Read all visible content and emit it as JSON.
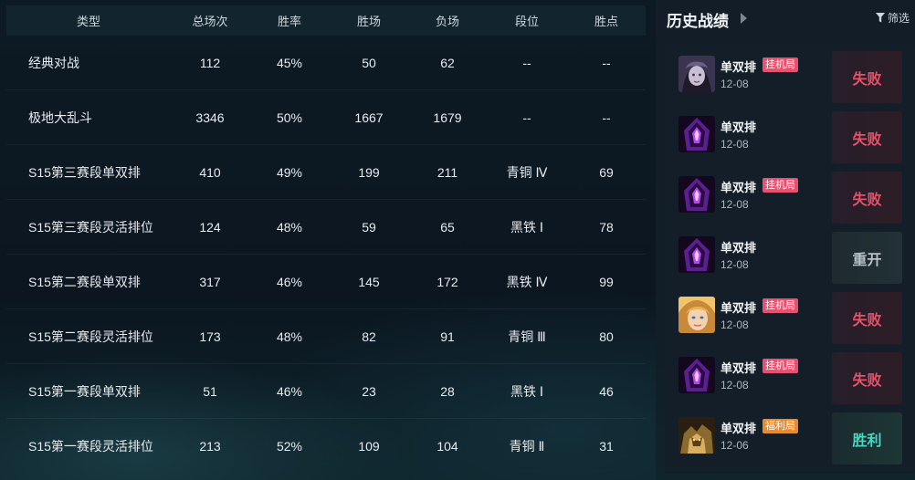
{
  "stats_table": {
    "headers": [
      "类型",
      "总场次",
      "胜率",
      "胜场",
      "负场",
      "段位",
      "胜点"
    ],
    "rows": [
      [
        "经典对战",
        "112",
        "45%",
        "50",
        "62",
        "--",
        "--"
      ],
      [
        "极地大乱斗",
        "3346",
        "50%",
        "1667",
        "1679",
        "--",
        "--"
      ],
      [
        "S15第三赛段单双排",
        "410",
        "49%",
        "199",
        "211",
        "青铜 Ⅳ",
        "69"
      ],
      [
        "S15第三赛段灵活排位",
        "124",
        "48%",
        "59",
        "65",
        "黑铁 Ⅰ",
        "78"
      ],
      [
        "S15第二赛段单双排",
        "317",
        "46%",
        "145",
        "172",
        "黑铁 Ⅳ",
        "99"
      ],
      [
        "S15第二赛段灵活排位",
        "173",
        "48%",
        "82",
        "91",
        "青铜 Ⅲ",
        "80"
      ],
      [
        "S15第一赛段单双排",
        "51",
        "46%",
        "23",
        "28",
        "黑铁 Ⅰ",
        "46"
      ],
      [
        "S15第一赛段灵活排位",
        "213",
        "52%",
        "109",
        "104",
        "青铜 Ⅱ",
        "31"
      ]
    ]
  },
  "history": {
    "title": "历史战绩",
    "filter_label": "筛选",
    "matches": [
      {
        "champion_icon": "pale-champion-portrait-icon",
        "queue": "单双排",
        "tag": "挂机局",
        "tag_color": "#e8506f",
        "date": "12-08",
        "result": "失败",
        "result_type": "loss"
      },
      {
        "champion_icon": "purple-hooded-champion-icon",
        "queue": "单双排",
        "tag": "",
        "tag_color": "",
        "date": "12-08",
        "result": "失败",
        "result_type": "loss"
      },
      {
        "champion_icon": "purple-hooded-champion-icon",
        "queue": "单双排",
        "tag": "挂机局",
        "tag_color": "#e8506f",
        "date": "12-08",
        "result": "失败",
        "result_type": "loss"
      },
      {
        "champion_icon": "purple-hooded-champion-icon",
        "queue": "单双排",
        "tag": "",
        "tag_color": "",
        "date": "12-08",
        "result": "重开",
        "result_type": "remake"
      },
      {
        "champion_icon": "blonde-champion-portrait-icon",
        "queue": "单双排",
        "tag": "挂机局",
        "tag_color": "#e8506f",
        "date": "12-08",
        "result": "失败",
        "result_type": "loss"
      },
      {
        "champion_icon": "purple-hooded-champion-icon",
        "queue": "单双排",
        "tag": "挂机局",
        "tag_color": "#e8506f",
        "date": "12-08",
        "result": "失败",
        "result_type": "loss"
      },
      {
        "champion_icon": "golden-armored-champion-icon",
        "queue": "单双排",
        "tag": "福利局",
        "tag_color": "#e88a2e",
        "date": "12-06",
        "result": "胜利",
        "result_type": "win"
      }
    ]
  },
  "colors": {
    "loss": "#e5526c",
    "win": "#47d7c3",
    "remake": "#b6c0c6"
  }
}
